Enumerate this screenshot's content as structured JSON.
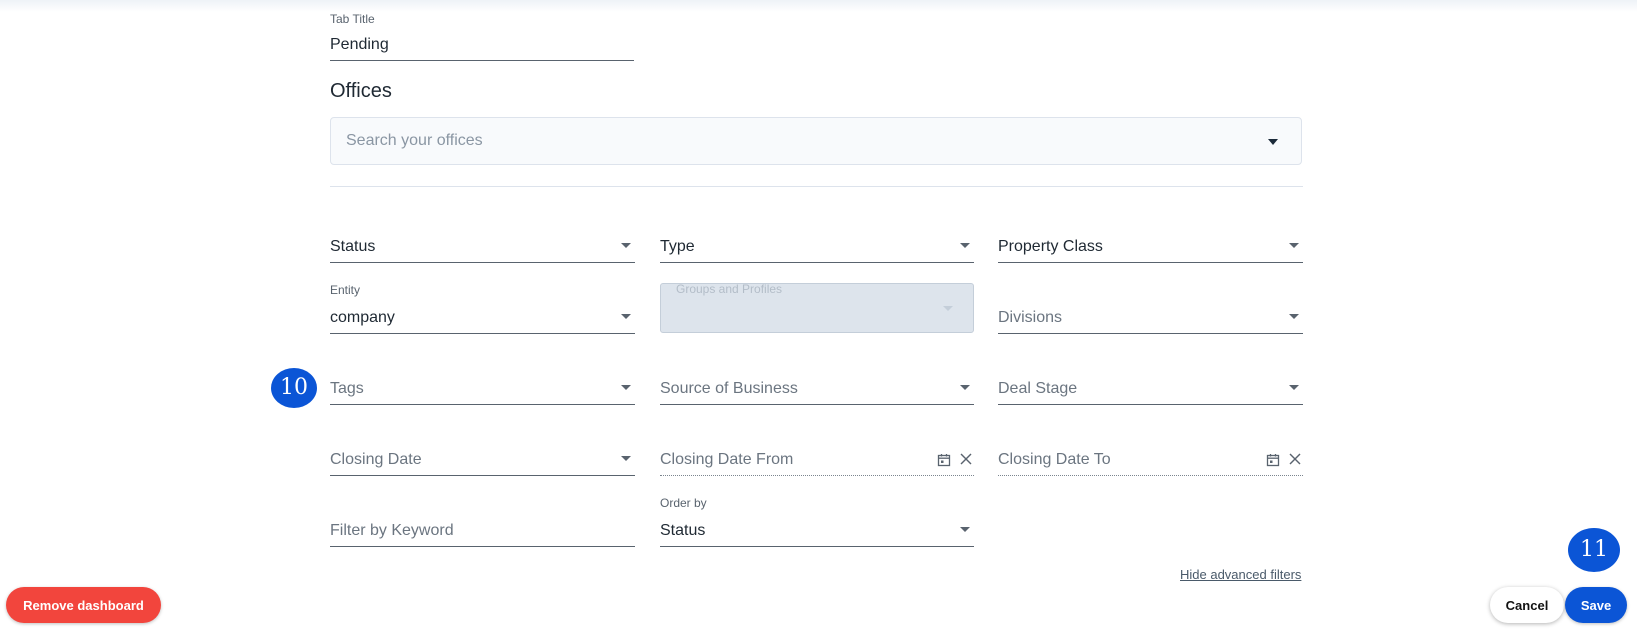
{
  "form": {
    "tab_title_label": "Tab Title",
    "tab_title_value": "Pending",
    "offices_heading": "Offices",
    "offices_search_placeholder": "Search your offices"
  },
  "filters": {
    "status": "Status",
    "type": "Type",
    "property_class": "Property Class",
    "entity_label": "Entity",
    "entity_value": "company",
    "groups_profiles_label": "Groups and Profiles",
    "divisions": "Divisions",
    "tags": "Tags",
    "source_of_business": "Source of Business",
    "deal_stage": "Deal Stage",
    "closing_date": "Closing Date",
    "closing_date_from": "Closing Date From",
    "closing_date_to": "Closing Date To",
    "filter_by_keyword": "Filter by Keyword",
    "order_by_label": "Order by",
    "order_by_value": "Status"
  },
  "links": {
    "hide_advanced_filters": "Hide advanced filters"
  },
  "buttons": {
    "remove_dashboard": "Remove dashboard",
    "cancel": "Cancel",
    "save": "Save"
  },
  "badges": {
    "tags_badge": "10",
    "save_badge": "11"
  },
  "colors": {
    "primary": "#0b55d6",
    "danger": "#f2453d",
    "input_border": "#59636e",
    "disabled_bg": "#dde4ec"
  },
  "icons": {
    "dropdown": "caret-down-icon",
    "calendar": "calendar-icon",
    "clear": "close-icon"
  }
}
